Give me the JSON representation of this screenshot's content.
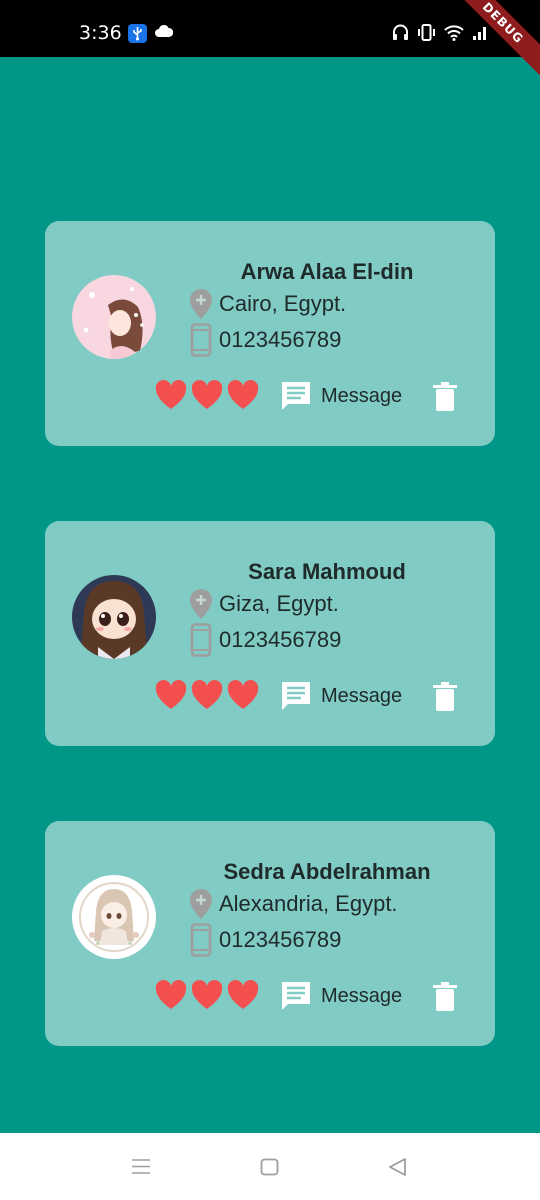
{
  "status_bar": {
    "time": "3:36",
    "debug_label": "DEBUG"
  },
  "contacts": [
    {
      "name": "Arwa Alaa El-din",
      "location": "Cairo, Egypt.",
      "phone": "0123456789",
      "hearts": 3,
      "message_label": "Message",
      "avatar": "girl-pink-avatar"
    },
    {
      "name": "Sara Mahmoud",
      "location": "Giza, Egypt.",
      "phone": "0123456789",
      "hearts": 3,
      "message_label": "Message",
      "avatar": "girl-dark-avatar"
    },
    {
      "name": "Sedra Abdelrahman",
      "location": "Alexandria, Egypt.",
      "phone": "0123456789",
      "hearts": 3,
      "message_label": "Message",
      "avatar": "girl-light-avatar"
    }
  ],
  "colors": {
    "background": "#009688",
    "card": "#80cbc4",
    "heart": "#f44f4f",
    "icon_grey": "#9e9e9e"
  }
}
